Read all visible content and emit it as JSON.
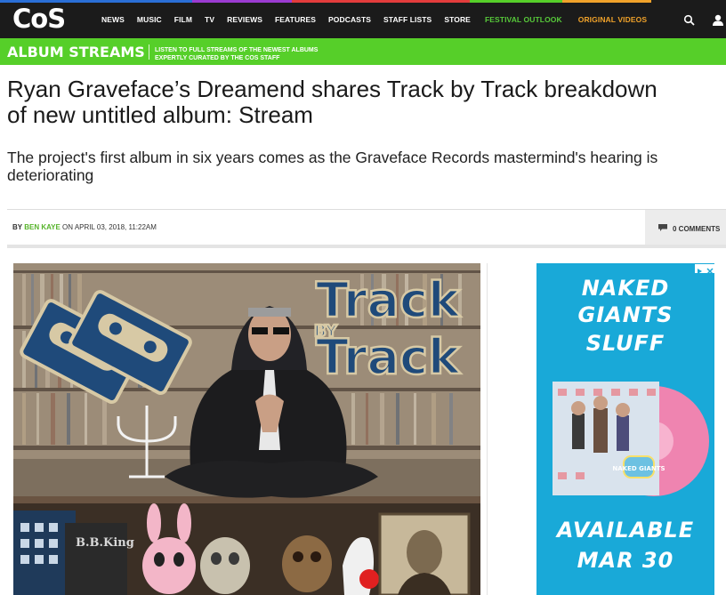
{
  "site": {
    "logo_text": "CoS",
    "nav": [
      "NEWS",
      "MUSIC",
      "FILM",
      "TV",
      "REVIEWS",
      "FEATURES",
      "PODCASTS",
      "STAFF LISTS",
      "STORE"
    ],
    "nav_highlight": [
      "FESTIVAL OUTLOOK",
      "ORIGINAL VIDEOS"
    ],
    "colors": {
      "nav_bg": "#1b1b1b",
      "green": "#56cf29",
      "orange": "#f0a22a",
      "accent_link": "#56b32a"
    }
  },
  "banner": {
    "title": "ALBUM STREAMS",
    "subtitle_line1": "LISTEN TO FULL STREAMS OF THE NEWEST ALBUMS",
    "subtitle_line2": "EXPERTLY CURATED BY THE COS STAFF"
  },
  "article": {
    "headline_line1": "Ryan Graveface’s Dreamend shares Track by Track breakdown",
    "headline_line2": "of new untitled album: Stream",
    "dek_line1": "The project's first album in six years comes as the Graveface Records mastermind's hearing is",
    "dek_line2": "deteriorating",
    "by_prefix": "BY",
    "author": "BEN KAYE",
    "date": "ON APRIL 03, 2018, 11:22AM",
    "comments": "0 COMMENTS"
  },
  "hero": {
    "overlay_line1": "Track",
    "overlay_line2": "BY",
    "overlay_line3": "Track",
    "sign_text": "B.B.King"
  },
  "ad": {
    "line1": "NAKED",
    "line2": "GIANTS",
    "line3": "SLUFF",
    "line4": "AVAILABLE",
    "line5": "MAR 30",
    "badge_text": "NAKED GIANTS"
  }
}
